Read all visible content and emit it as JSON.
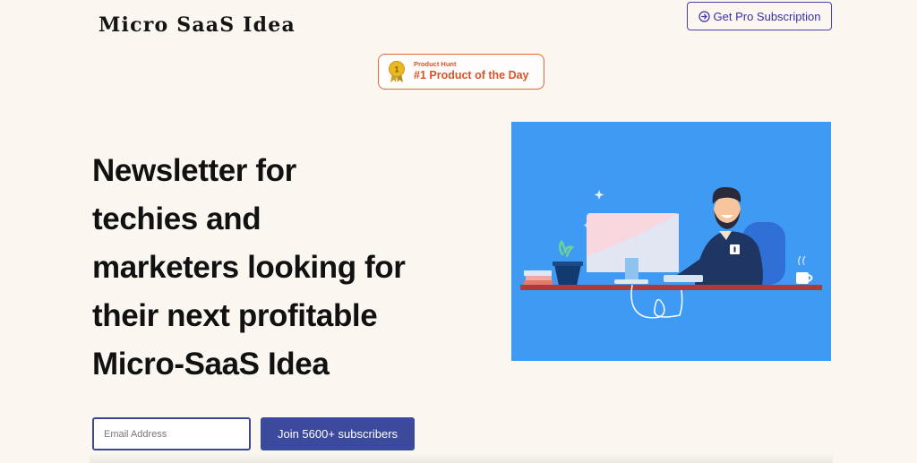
{
  "header": {
    "logo_text": "Micro SaaS Idea",
    "pro_button_label": "Get Pro Subscription"
  },
  "badge": {
    "small_text": "Product Hunt",
    "main_text": "#1 Product of the Day",
    "medal_number": "1"
  },
  "hero": {
    "headline_lines": [
      "Newsletter for",
      "techies and",
      "marketers looking for",
      "their next profitable",
      "Micro-SaaS Idea"
    ]
  },
  "signup": {
    "email_placeholder": "Email Address",
    "email_value": "",
    "join_button_label": "Join 5600+ subscribers"
  },
  "colors": {
    "background": "#fbf7f0",
    "accent": "#3b4a9c",
    "badge": "#d9532b",
    "hero_bg": "#3f9af4"
  }
}
